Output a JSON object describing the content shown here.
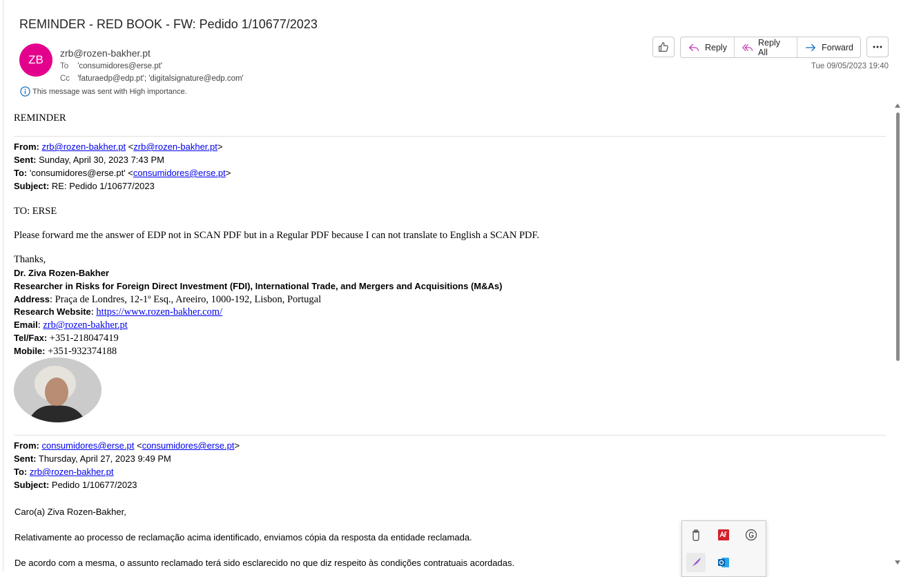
{
  "email": {
    "subject": "REMINDER - RED BOOK - FW: Pedido 1/10677/2023",
    "avatar_initials": "ZB",
    "sender": "zrb@rozen-bakher.pt",
    "to_label": "To",
    "to_value": "'consumidores@erse.pt'",
    "cc_label": "Cc",
    "cc_value": "'faturaedp@edp.pt'; 'digitalsignature@edp.com'",
    "importance": "This message was sent with High importance.",
    "date": "Tue 09/05/2023 19:40",
    "accent_color": "#e3008c"
  },
  "toolbar": {
    "reply": "Reply",
    "reply_all": "Reply All",
    "forward": "Forward"
  },
  "body": {
    "reminder": "REMINDER",
    "msg1": {
      "from_label": "From:",
      "from_link": "zrb@rozen-bakher.pt",
      "from_lt": " <",
      "from_link2": "zrb@rozen-bakher.pt",
      "from_gt": ">",
      "sent_label": "Sent:",
      "sent_value": " Sunday, April 30, 2023 7:43 PM",
      "to_label": "To:",
      "to_value": " 'consumidores@erse.pt' <",
      "to_link": "consumidores@erse.pt",
      "to_gt": ">",
      "subject_label": "Subject:",
      "subject_value": " RE: Pedido 1/10677/2023",
      "to_erse": "TO: ERSE",
      "para": "Please forward me the answer of EDP not in SCAN PDF but in a Regular PDF because I can not translate to English a SCAN PDF.",
      "thanks": "Thanks,"
    },
    "signature": {
      "name": "Dr. Ziva Rozen-Bakher",
      "title": "Researcher in Risks for Foreign Direct Investment (FDI), International Trade, and Mergers and Acquisitions (M&As)",
      "address_label": "Address",
      "address_value": ": Praça de Londres, 12-1º Esq., Areeiro, 1000-192, Lisbon, Portugal",
      "website_label": "Research Website",
      "website_colon": ": ",
      "website_link": "https://www.rozen-bakher.com/",
      "email_label": "Email",
      "email_colon": ": ",
      "email_link": "zrb@rozen-bakher.pt",
      "tel_label": "Tel/Fax:",
      "tel_value": " +351-218047419",
      "mobile_label": "Mobile:",
      "mobile_value": " +351-932374188"
    },
    "msg2": {
      "from_label": "From:",
      "from_link": "consumidores@erse.pt",
      "from_lt": " <",
      "from_link2": "consumidores@erse.pt",
      "from_gt": ">",
      "sent_label": "Sent:",
      "sent_value": " Thursday, April 27, 2023 9:49 PM",
      "to_label": "To:",
      "to_link": "zrb@rozen-bakher.pt",
      "subject_label": "Subject:",
      "subject_value": " Pedido 1/10677/2023",
      "greeting": "Caro(a) Ziva Rozen-Bakher,",
      "para1": "Relativamente ao processo de reclamação acima identificado, enviamos cópia da resposta da entidade reclamada.",
      "para2": "De acordo com a mesma, o assunto reclamado terá sido esclarecido no que diz respeito às condições contratuais acordadas."
    }
  }
}
